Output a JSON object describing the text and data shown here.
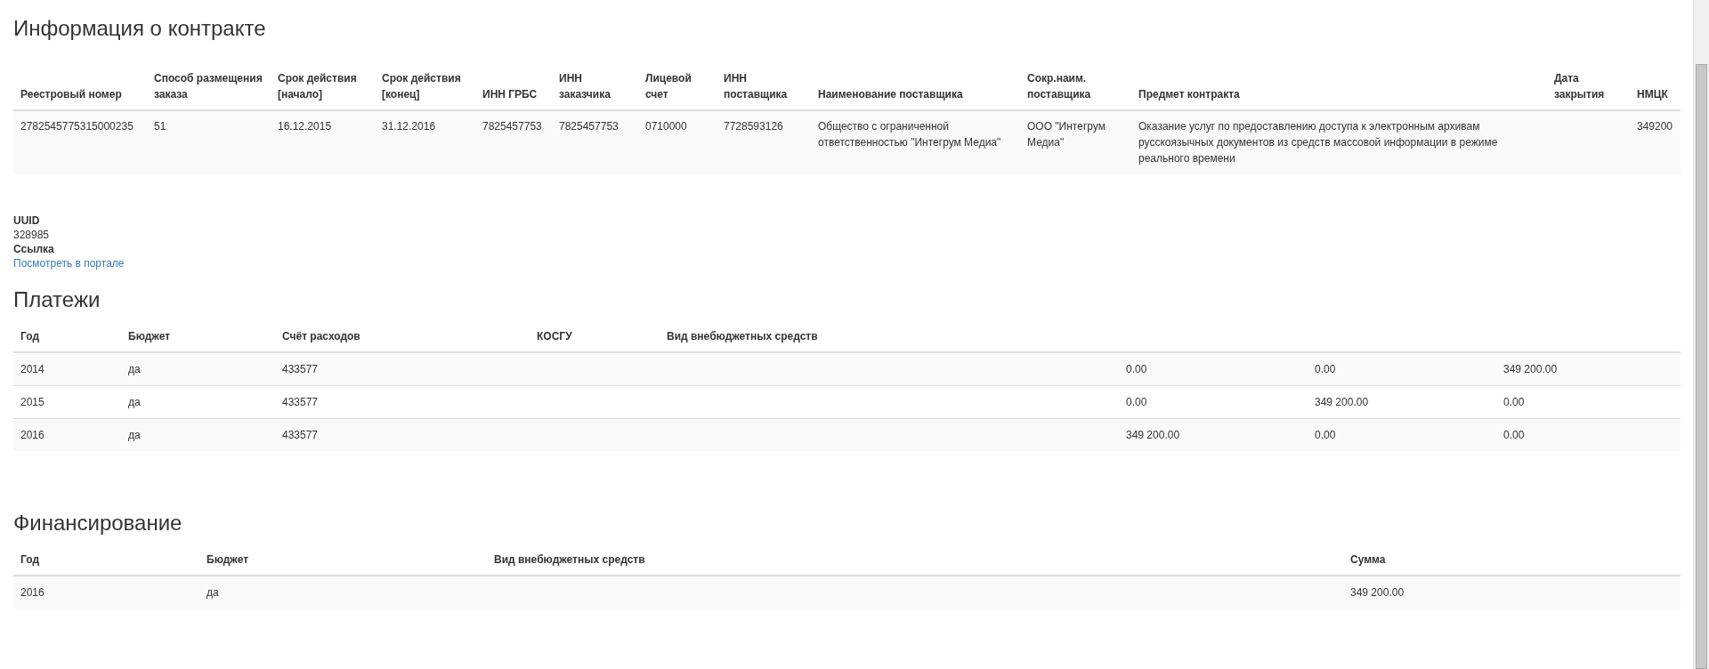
{
  "contract": {
    "title": "Информация о контракте",
    "columns": [
      "Реестровый номер",
      "Способ размещения заказа",
      "Срок действия [начало]",
      "Срок действия [конец]",
      "ИНН ГРБС",
      "ИНН заказчика",
      "Лицевой счет",
      "ИНН поставщика",
      "Наименование поставщика",
      "Сокр.наим. поставщика",
      "Предмет контракта",
      "Дата закрытия",
      "НМЦК"
    ],
    "rows": [
      [
        "2782545775315000235",
        "51",
        "16.12.2015",
        "31.12.2016",
        "7825457753",
        "7825457753",
        "0710000",
        "7728593126",
        "Общество с ограниченной ответственностью \"Интегрум Медиа\"",
        "ООО \"Интегрум Медиа\"",
        "Оказание услуг по предоставлению доступа к электронным архивам русскоязычных документов из средств массовой информации в режиме реального времени",
        "",
        "349200"
      ]
    ]
  },
  "details": [
    {
      "label": "UUID",
      "value": "328985",
      "kind": "text"
    },
    {
      "label": "Ссылка",
      "value": "Посмотреть в портале",
      "kind": "link"
    }
  ],
  "payments": {
    "title": "Платежи",
    "columns": [
      "Год",
      "Бюджет",
      "Счёт расходов",
      "КОСГУ",
      "Вид внебюджетных средств",
      "",
      "",
      ""
    ],
    "rows": [
      [
        "2014",
        "да",
        "433577",
        "",
        "",
        "0.00",
        "0.00",
        "349 200.00"
      ],
      [
        "2015",
        "да",
        "433577",
        "",
        "",
        "0.00",
        "349 200.00",
        "0.00"
      ],
      [
        "2016",
        "да",
        "433577",
        "",
        "",
        "349 200.00",
        "0.00",
        "0.00"
      ]
    ]
  },
  "financing": {
    "title": "Финансирование",
    "columns": [
      "Год",
      "Бюджет",
      "Вид внебюджетных средств",
      "Сумма"
    ],
    "rows": [
      [
        "2016",
        "да",
        "",
        "349 200.00"
      ]
    ]
  }
}
